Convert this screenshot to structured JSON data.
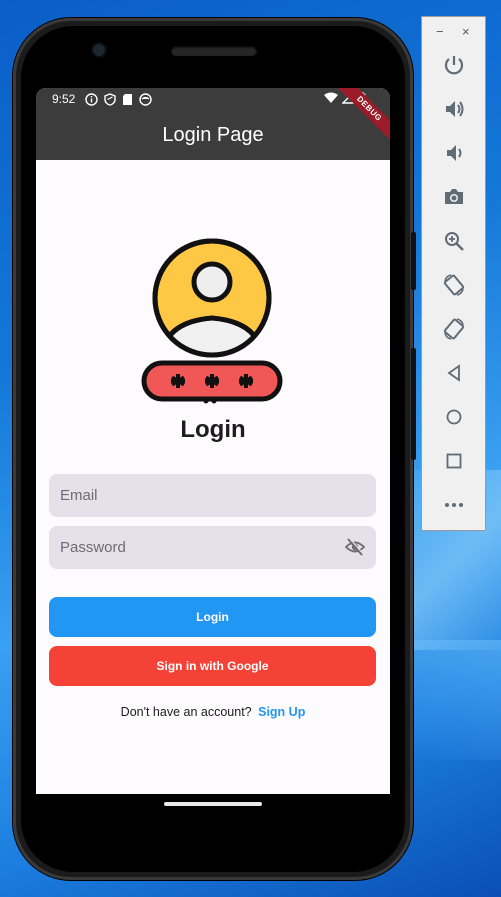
{
  "emulator_toolbar": {
    "minimize_label": "−",
    "close_label": "×",
    "tools": [
      "power-icon",
      "volume-up-icon",
      "volume-down-icon",
      "camera-icon",
      "zoom-icon",
      "rotate-left-icon",
      "rotate-right-icon",
      "back-icon",
      "home-icon",
      "overview-icon",
      "more-icon"
    ]
  },
  "status_bar": {
    "time": "9:52"
  },
  "app_bar": {
    "title": "Login Page",
    "debug_banner": "DEBUG"
  },
  "login": {
    "heading": "Login",
    "email_placeholder": "Email",
    "password_placeholder": "Password",
    "login_button": "Login",
    "google_button": "Sign in with Google",
    "signup_prompt": "Don't have an account?",
    "signup_link": "Sign Up"
  },
  "colors": {
    "app_bar": "#3c3c3c",
    "login_button": "#2196f3",
    "google_button": "#f44336",
    "signup_link": "#2196f3",
    "field_bg": "#e5e0ea"
  }
}
